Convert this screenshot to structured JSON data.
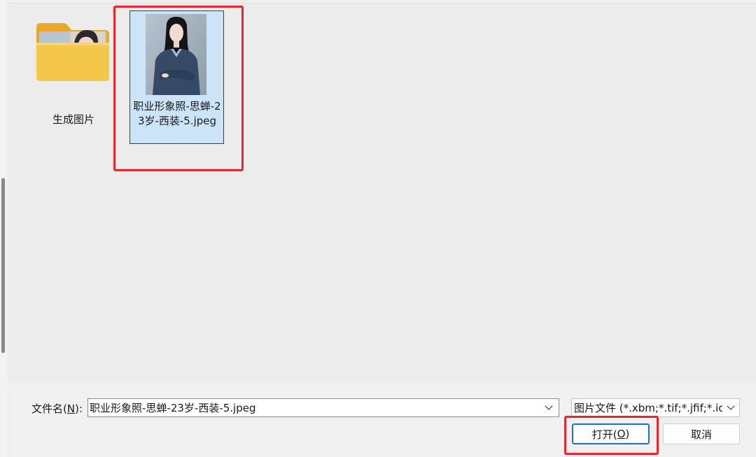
{
  "items": {
    "folder": {
      "label": "生成图片",
      "icon": "folder-icon"
    },
    "image": {
      "label": "职业形象照-思蝉-23岁-西装-5.jpeg",
      "icon": "image-thumbnail"
    }
  },
  "bottom": {
    "filename_label_pre": "文件名(",
    "filename_label_key": "N",
    "filename_label_post": "):",
    "filename_value": "职业形象照-思蝉-23岁-西装-5.jpeg",
    "filetype_value": "图片文件 (*.xbm;*.tif;*.jfif;*.ico;",
    "open_pre": "打开(",
    "open_key": "O",
    "open_post": ")",
    "cancel_label": "取消"
  },
  "colors": {
    "selection": "#cce4f7",
    "highlight_box": "#e5282b",
    "accent": "#1f6fc7"
  }
}
